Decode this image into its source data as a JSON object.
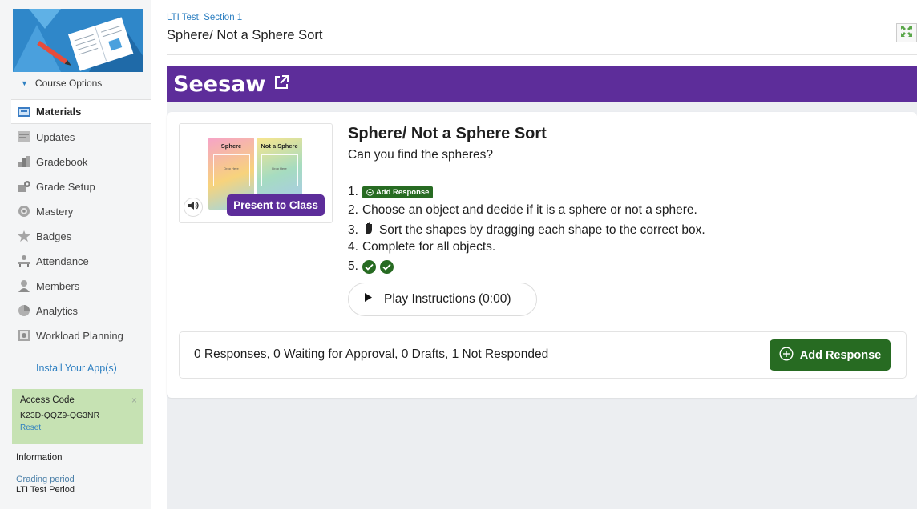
{
  "sidebar": {
    "course_options": "Course Options",
    "items": [
      {
        "label": "Materials",
        "icon": "materials-icon",
        "active": true
      },
      {
        "label": "Updates",
        "icon": "updates-icon"
      },
      {
        "label": "Gradebook",
        "icon": "gradebook-icon"
      },
      {
        "label": "Grade Setup",
        "icon": "grade-setup-icon"
      },
      {
        "label": "Mastery",
        "icon": "mastery-icon"
      },
      {
        "label": "Badges",
        "icon": "badges-icon"
      },
      {
        "label": "Attendance",
        "icon": "attendance-icon"
      },
      {
        "label": "Members",
        "icon": "members-icon"
      },
      {
        "label": "Analytics",
        "icon": "analytics-icon"
      },
      {
        "label": "Workload Planning",
        "icon": "workload-planning-icon"
      }
    ],
    "install_apps": "Install Your App(s)",
    "access_code": {
      "title": "Access Code",
      "code": "K23D-QQZ9-QG3NR",
      "reset": "Reset",
      "close": "×"
    },
    "information": {
      "heading": "Information",
      "grading_period_label": "Grading period",
      "grading_period_value": "LTI Test Period"
    }
  },
  "header": {
    "breadcrumb": "LTI Test: Section 1",
    "title": "Sphere/ Not a Sphere Sort"
  },
  "seesaw": {
    "logo": "Seesaw",
    "thumbnail": {
      "left_label": "Sphere",
      "right_label": "Not a Sphere",
      "drop_text": "Drop Here"
    },
    "present_button": "Present to Class",
    "activity_title": "Sphere/ Not a Sphere Sort",
    "activity_subtitle": "Can you find the spheres?",
    "steps": [
      {
        "num": "1.",
        "button": "Add Response"
      },
      {
        "num": "2.",
        "text": "Choose an object and decide if it is a sphere or not a sphere."
      },
      {
        "num": "3.",
        "text": "Sort the shapes by dragging each shape to the correct box."
      },
      {
        "num": "4.",
        "text": "Complete for all objects."
      },
      {
        "num": "5."
      }
    ],
    "play_button": "Play Instructions (0:00)",
    "responses_summary": "0 Responses, 0 Waiting for Approval, 0 Drafts, 1 Not Responded",
    "add_response_button": "Add Response"
  },
  "colors": {
    "seesaw_purple": "#5d2d9a",
    "seesaw_green": "#276b22",
    "link_blue": "#2d7fc1",
    "access_code_bg": "#c6e2b3"
  }
}
